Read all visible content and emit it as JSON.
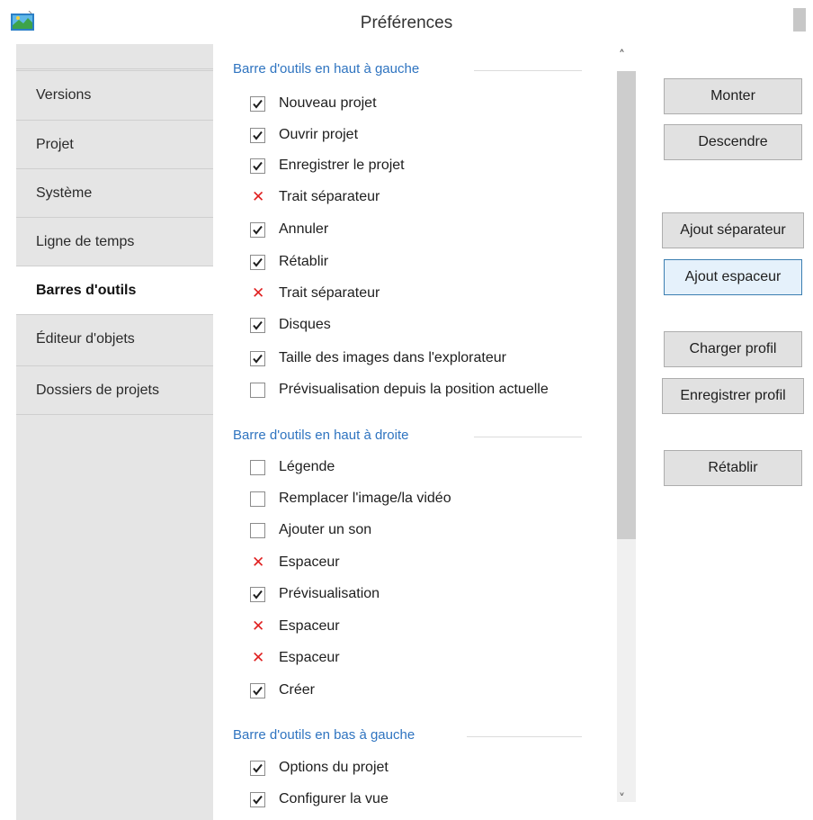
{
  "window": {
    "title": "Préférences"
  },
  "sidebar": {
    "items": [
      {
        "label": "Versions",
        "active": false
      },
      {
        "label": "Projet",
        "active": false
      },
      {
        "label": "Système",
        "active": false
      },
      {
        "label": "Ligne de temps",
        "active": false
      },
      {
        "label": "Barres d'outils",
        "active": true
      },
      {
        "label": "Éditeur d'objets",
        "active": false
      },
      {
        "label": "Dossiers de projets",
        "active": false
      }
    ]
  },
  "groups": [
    {
      "header": "Barre d'outils en haut à gauche",
      "items": [
        {
          "label": "Nouveau projet",
          "state": "checked"
        },
        {
          "label": "Ouvrir projet",
          "state": "checked"
        },
        {
          "label": "Enregistrer le projet",
          "state": "checked"
        },
        {
          "label": "Trait séparateur",
          "state": "cross"
        },
        {
          "label": "Annuler",
          "state": "checked"
        },
        {
          "label": "Rétablir",
          "state": "checked"
        },
        {
          "label": "Trait séparateur",
          "state": "cross"
        },
        {
          "label": "Disques",
          "state": "checked"
        },
        {
          "label": "Taille des images dans l'explorateur",
          "state": "checked"
        },
        {
          "label": "Prévisualisation depuis la position actuelle",
          "state": "unchecked"
        }
      ]
    },
    {
      "header": "Barre d'outils en haut à droite",
      "items": [
        {
          "label": "Légende",
          "state": "unchecked"
        },
        {
          "label": "Remplacer l'image/la vidéo",
          "state": "unchecked"
        },
        {
          "label": "Ajouter un son",
          "state": "unchecked"
        },
        {
          "label": "Espaceur",
          "state": "cross"
        },
        {
          "label": "Prévisualisation",
          "state": "checked"
        },
        {
          "label": "Espaceur",
          "state": "cross"
        },
        {
          "label": "Espaceur",
          "state": "cross"
        },
        {
          "label": "Créer",
          "state": "checked"
        }
      ]
    },
    {
      "header": "Barre d'outils en bas à gauche",
      "items": [
        {
          "label": "Options du projet",
          "state": "checked"
        },
        {
          "label": "Configurer la vue",
          "state": "checked"
        }
      ]
    }
  ],
  "buttons": {
    "move_up": "Monter",
    "move_down": "Descendre",
    "add_separator": "Ajout séparateur",
    "add_spacer": "Ajout espaceur",
    "load_profile": "Charger profil",
    "save_profile": "Enregistrer profil",
    "restore": "Rétablir"
  },
  "colors": {
    "accent": "#2f74c0",
    "cross": "#e02020",
    "sidebar_bg": "#e5e5e5"
  },
  "scroll": {
    "position": 0.0,
    "visible_fraction": 0.64
  }
}
